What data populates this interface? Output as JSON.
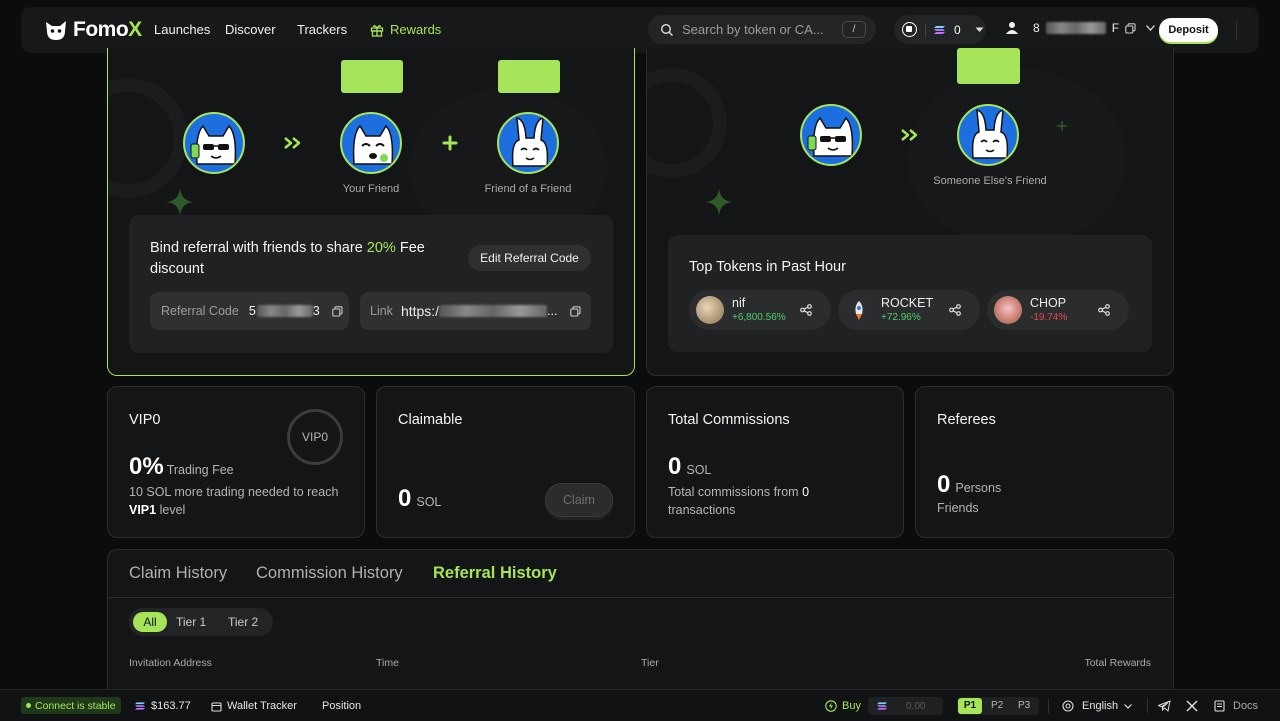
{
  "header": {
    "logo": {
      "text_main": "Fomo",
      "text_accent": "X"
    },
    "nav": [
      "Launches",
      "Discover",
      "Trackers"
    ],
    "rewards_label": "Rewards",
    "search_placeholder": "Search by token or CA...",
    "search_shortcut": "/",
    "sol_balance": "0",
    "account_suffix": "F",
    "deposit_label": "Deposit"
  },
  "referral": {
    "your_friend": "Your Friend",
    "friend_of_friend": "Friend of a Friend",
    "someone_else": "Someone Else's Friend",
    "bind_prefix": "Bind referral with friends to share ",
    "bind_percent": "20%",
    "bind_suffix": " Fee discount",
    "edit_button": "Edit Referral Code",
    "code_label": "Referral Code",
    "code_start": "5",
    "code_end": "3",
    "link_label": "Link",
    "link_value": "https:/",
    "link_ellipsis": "..."
  },
  "top_tokens": {
    "title": "Top Tokens in Past Hour",
    "items": [
      {
        "name": "nif",
        "change": "+6,800.56%",
        "color": "#4ccf6a"
      },
      {
        "name": "ROCKET",
        "change": "+72.96%",
        "color": "#4ccf6a"
      },
      {
        "name": "CHOP",
        "change": "-19.74%",
        "color": "#e5484d"
      }
    ]
  },
  "stats": {
    "vip": {
      "title": "VIP0",
      "badge": "VIP0",
      "value": "0%",
      "unit": "Trading Fee",
      "note": "10 SOL more trading needed to reach",
      "next_level": "VIP1",
      "level_word": "level"
    },
    "claimable": {
      "title": "Claimable",
      "value": "0",
      "unit": "SOL",
      "button": "Claim"
    },
    "commissions": {
      "title": "Total Commissions",
      "value": "0",
      "unit": "SOL",
      "note_prefix": "Total commissions from",
      "count": "0",
      "note_suffix": "transactions"
    },
    "referees": {
      "title": "Referees",
      "value": "0",
      "unit": "Persons",
      "sub": "Friends"
    }
  },
  "history": {
    "tabs": [
      "Claim History",
      "Commission History",
      "Referral History"
    ],
    "active_tab": 2,
    "filters": [
      "All",
      "Tier 1",
      "Tier 2"
    ],
    "columns": [
      "Invitation Address",
      "Time",
      "Tier",
      "Total Rewards"
    ]
  },
  "footer": {
    "status": "Connect is stable",
    "balance": "$163.77",
    "wallet_tracker": "Wallet Tracker",
    "position": "Position",
    "buy": "Buy",
    "buy_amount": "0.00",
    "presets": [
      "P1",
      "P2",
      "P3"
    ],
    "language": "English",
    "docs": "Docs"
  },
  "colors": {
    "accent": "#a6e45a",
    "up": "#4ccf6a",
    "down": "#e5484d"
  }
}
